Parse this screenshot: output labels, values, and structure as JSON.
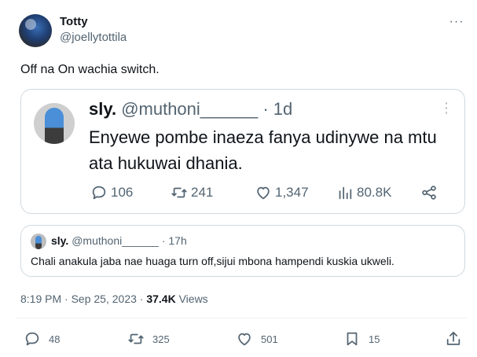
{
  "author": {
    "name": "Totty",
    "handle": "@joellytottila"
  },
  "more_label": "···",
  "tweet_text": "Off na On wachia switch.",
  "quoted": {
    "name": "sly.",
    "handle": "@muthoni______",
    "time": "· 1d",
    "text": "Enyewe pombe inaeza fanya udinywe na mtu ata hukuwai dhania.",
    "more_label": "⋮",
    "stats": {
      "replies": "106",
      "retweets": "241",
      "likes": "1,347",
      "views": "80.8K"
    }
  },
  "quoted2": {
    "name": "sly.",
    "handle": "@muthoni______",
    "time": "· 17h",
    "text": "Chali anakula jaba nae huaga turn off,sijui mbona hampendi kuskia ukweli."
  },
  "meta": {
    "time": "8:19 PM",
    "date": "Sep 25, 2023",
    "views_count": "37.4K",
    "views_label": "Views"
  },
  "actions": {
    "replies": "48",
    "retweets": "325",
    "likes": "501",
    "bookmarks": "15"
  },
  "icons": [
    "reply-icon",
    "retweet-icon",
    "like-icon",
    "views-icon",
    "share-icon",
    "bookmark-icon",
    "more-icon"
  ]
}
